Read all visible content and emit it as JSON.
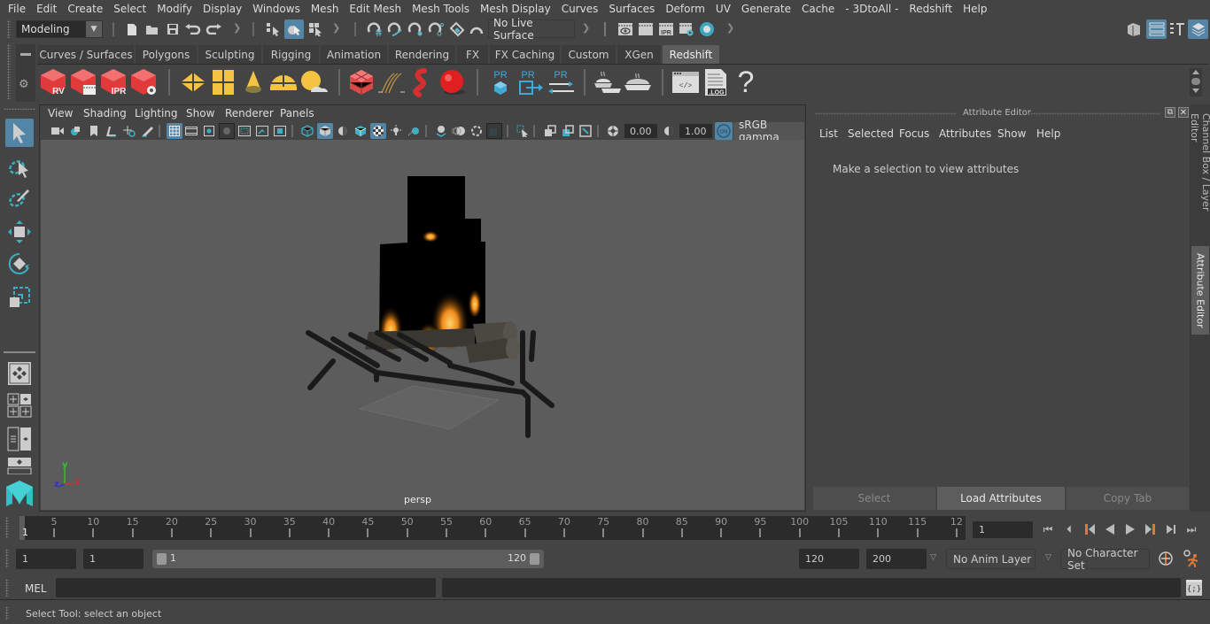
{
  "menubar": {
    "items": [
      "File",
      "Edit",
      "Create",
      "Select",
      "Modify",
      "Display",
      "Windows",
      "Mesh",
      "Edit Mesh",
      "Mesh Tools",
      "Mesh Display",
      "Curves",
      "Surfaces",
      "Deform",
      "UV",
      "Generate",
      "Cache",
      "- 3DtoAll -",
      "Redshift",
      "Help"
    ]
  },
  "statusline": {
    "menuset": "Modeling",
    "live_surface": "No Live Surface",
    "icons": [
      "new-scene-icon",
      "open-scene-icon",
      "save-scene-icon",
      "undo-icon",
      "redo-icon",
      "select-by-hierarchy-icon",
      "select-by-object-icon",
      "select-by-component-icon",
      "snap-to-grid-icon",
      "snap-to-curve-icon",
      "snap-to-point-icon",
      "snap-to-projected-center-icon",
      "snap-to-view-plane-icon",
      "make-live-icon",
      "render-view-icon",
      "render-current-frame-icon",
      "ipr-render-icon",
      "render-settings-icon",
      "hypershade-icon"
    ],
    "right_icons": [
      "modeling-toolkit-icon",
      "attribute-editor-toggle-icon",
      "tool-settings-icon",
      "channel-box-icon"
    ]
  },
  "shelf": {
    "tabs": [
      "Curves / Surfaces",
      "Polygons",
      "Sculpting",
      "Rigging",
      "Animation",
      "Rendering",
      "FX",
      "FX Caching",
      "Custom",
      "XGen",
      "Redshift"
    ],
    "active_tab": "Redshift",
    "icons": [
      {
        "name": "redshift-render-view-icon",
        "label": "RV"
      },
      {
        "name": "redshift-batch-render-icon",
        "label": ""
      },
      {
        "name": "redshift-ipr-icon",
        "label": "IPR"
      },
      {
        "name": "redshift-render-settings-icon",
        "label": ""
      },
      {
        "name": "redshift-area-light-icon",
        "label": ""
      },
      {
        "name": "redshift-portal-light-icon",
        "label": ""
      },
      {
        "name": "redshift-spot-light-icon",
        "label": ""
      },
      {
        "name": "redshift-dome-light-icon",
        "label": ""
      },
      {
        "name": "redshift-sun-sky-icon",
        "label": ""
      },
      {
        "name": "redshift-volume-icon",
        "label": ""
      },
      {
        "name": "redshift-hair-icon",
        "label": ""
      },
      {
        "name": "redshift-mesh-light-icon",
        "label": ""
      },
      {
        "name": "redshift-sphere-icon",
        "label": ""
      },
      {
        "name": "redshift-proxy-icon",
        "label": "PR"
      },
      {
        "name": "redshift-proxy-export-icon",
        "label": "PR"
      },
      {
        "name": "redshift-proxy-swap-icon",
        "label": "PR"
      },
      {
        "name": "redshift-baking-multiple-icon",
        "label": ""
      },
      {
        "name": "redshift-baking-icon",
        "label": ""
      },
      {
        "name": "redshift-script-editor-icon",
        "label": ""
      },
      {
        "name": "redshift-log-icon",
        "label": ".LOG"
      },
      {
        "name": "redshift-help-icon",
        "label": "?"
      }
    ]
  },
  "toolbox": {
    "tools": [
      "select-tool-icon",
      "lasso-tool-icon",
      "paint-select-tool-icon",
      "move-tool-icon",
      "rotate-tool-icon",
      "scale-tool-icon"
    ],
    "layouts": [
      "single-perspective-layout-icon",
      "four-view-layout-icon",
      "outliner-persp-layout-icon",
      "persp-graph-layout-icon"
    ]
  },
  "viewport": {
    "menus": [
      "View",
      "Shading",
      "Lighting",
      "Show",
      "Renderer",
      "Panels"
    ],
    "exposure": "0.00",
    "gamma": "1.00",
    "color_mgmt_badge": "ON",
    "color_space": "sRGB gamma",
    "camera_label": "persp",
    "axis": {
      "x": "x",
      "y": "y",
      "z": "z"
    }
  },
  "attribute_editor": {
    "title": "Attribute Editor",
    "menus": [
      "List",
      "Selected",
      "Focus",
      "Attributes",
      "Show",
      "Help"
    ],
    "message": "Make a selection to view attributes",
    "buttons": {
      "select": "Select",
      "load": "Load Attributes",
      "copy": "Copy Tab"
    },
    "side_tabs": {
      "channel_box": "Channel Box / Layer Editor",
      "attr_editor": "Attribute Editor"
    }
  },
  "timeline": {
    "start_label": "1",
    "ticks": [
      "5",
      "10",
      "15",
      "20",
      "25",
      "30",
      "35",
      "40",
      "45",
      "50",
      "55",
      "60",
      "65",
      "70",
      "75",
      "80",
      "85",
      "90",
      "95",
      "100",
      "105",
      "110",
      "115",
      "12"
    ],
    "current_frame": "1",
    "colors": {
      "key_marker": "#d9793a",
      "accent": "#5285a6"
    }
  },
  "range": {
    "start_frame": "1",
    "playback_start": "1",
    "slider_start": "1",
    "slider_end": "120",
    "playback_end": "120",
    "end_frame": "200",
    "anim_layer": "No Anim Layer",
    "character_set": "No Character Set"
  },
  "command_line": {
    "language": "MEL",
    "input": "",
    "output": ""
  },
  "help_line": {
    "text": "Select Tool: select an object"
  }
}
